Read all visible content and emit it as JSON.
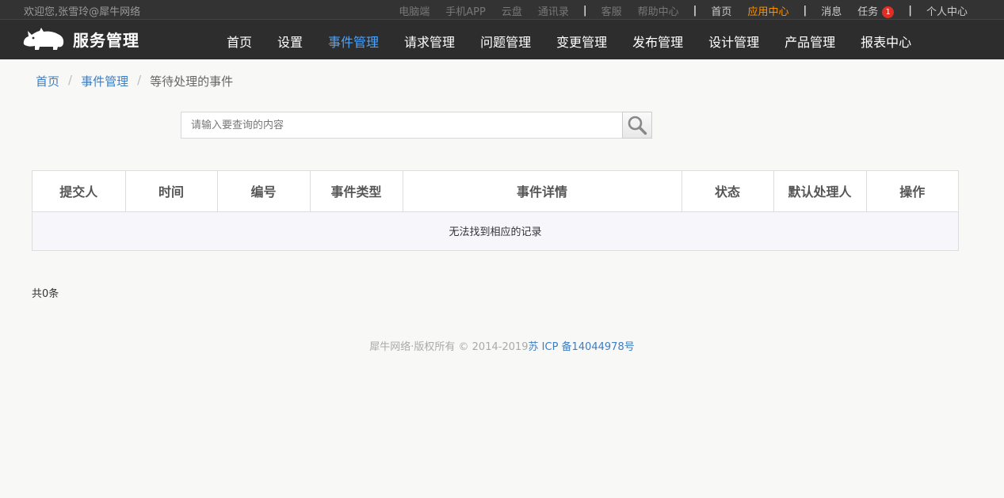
{
  "topbar": {
    "welcome": "欢迎您,张雪玲@犀牛网络",
    "links_group1": [
      "电脑端",
      "手机APP",
      "云盘",
      "通讯录"
    ],
    "links_group2": [
      "客服",
      "帮助中心"
    ],
    "home": "首页",
    "app_center": "应用中心",
    "messages": "消息",
    "tasks": "任务",
    "task_count": "1",
    "profile": "个人中心",
    "separator": "|"
  },
  "brand": {
    "title": "服务管理",
    "logo_icon": "rhino-icon"
  },
  "nav": {
    "items": [
      "首页",
      "设置",
      "事件管理",
      "请求管理",
      "问题管理",
      "变更管理",
      "发布管理",
      "设计管理",
      "产品管理",
      "报表中心"
    ],
    "active": "事件管理"
  },
  "breadcrumb": {
    "home": "首页",
    "section": "事件管理",
    "current": "等待处理的事件",
    "separator": "/"
  },
  "search": {
    "placeholder": "请输入要查询的内容",
    "value": "",
    "icon": "search-icon"
  },
  "table": {
    "columns": [
      "提交人",
      "时间",
      "编号",
      "事件类型",
      "事件详情",
      "状态",
      "默认处理人",
      "操作"
    ],
    "empty_message": "无法找到相应的记录"
  },
  "pagination": {
    "total_text": "共0条"
  },
  "footer": {
    "copyright": "犀牛网络·版权所有 © 2014-2019",
    "icp": "苏 ICP 备14044978号"
  },
  "colors": {
    "topbar_bg": "#333333",
    "nav_bg": "#2d2d2d",
    "nav_active": "#4aa3ff",
    "highlight": "#ff9400",
    "link": "#3b7ec4",
    "badge": "#e02e24"
  }
}
